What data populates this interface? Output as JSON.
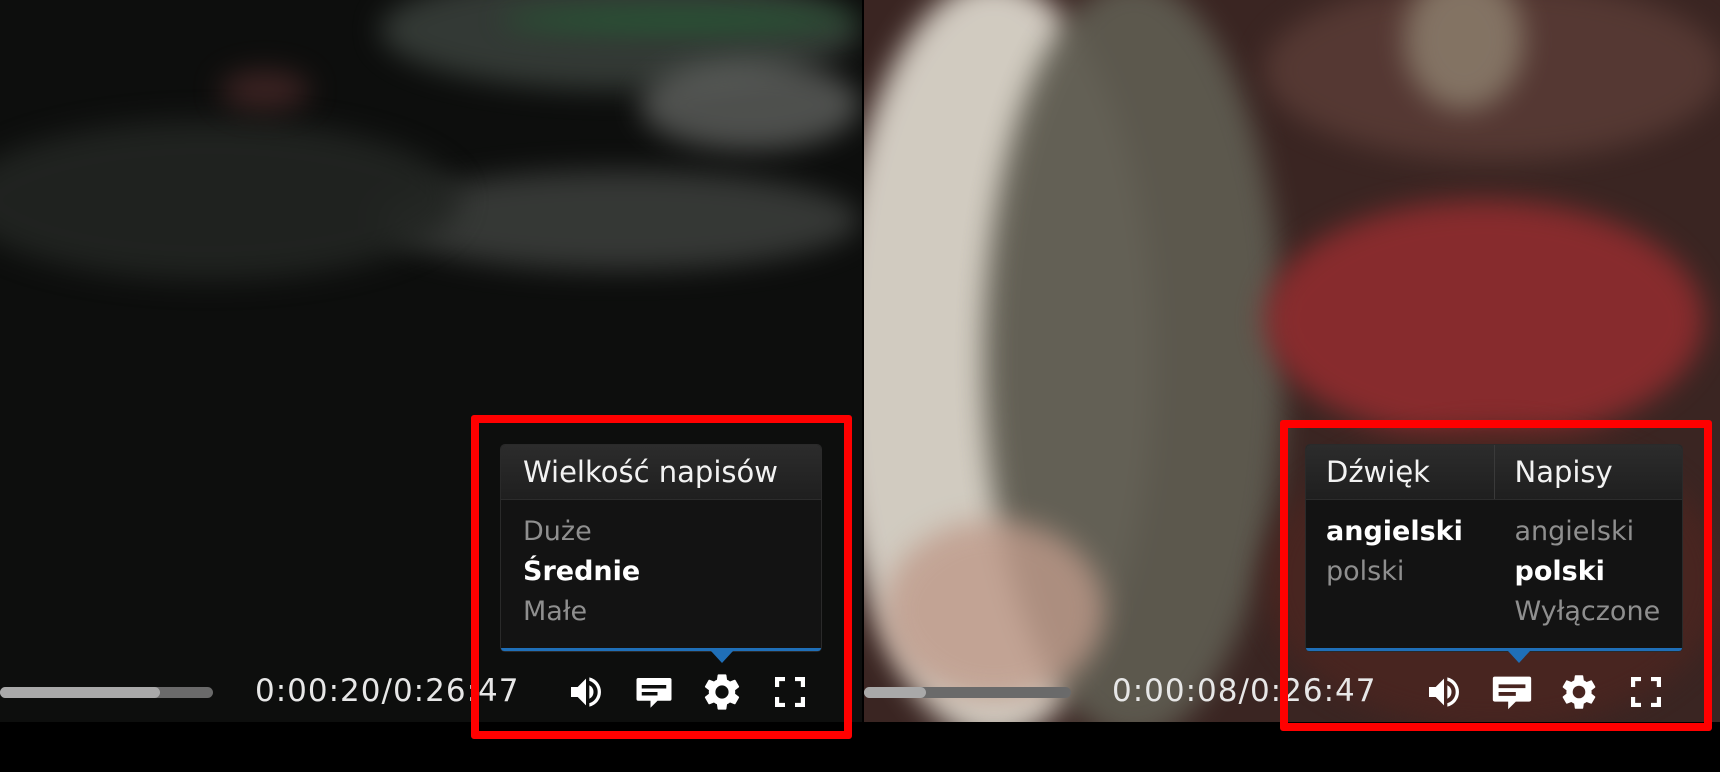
{
  "left": {
    "time_label": "0:00:20/0:26:47",
    "progress_fraction": 0.75,
    "menu": {
      "title": "Wielkość napisów",
      "options": [
        "Duże",
        "Średnie",
        "Małe"
      ],
      "selected": "Średnie"
    }
  },
  "right": {
    "time_label": "0:00:08/0:26:47",
    "progress_fraction": 0.3,
    "menu": {
      "audio_title": "Dźwięk",
      "subtitles_title": "Napisy",
      "audio_options": [
        "angielski",
        "polski"
      ],
      "audio_selected": "angielski",
      "subtitle_options": [
        "angielski",
        "polski",
        "Wyłączone"
      ],
      "subtitle_selected": "polski"
    }
  },
  "icons": {
    "volume": "volume-icon",
    "subtitles": "subtitles-icon",
    "settings": "gear-icon",
    "fullscreen": "fullscreen-icon"
  },
  "colors": {
    "highlight": "#ff0000",
    "menu_accent": "#1f6fb8",
    "menu_background": "#131313"
  }
}
